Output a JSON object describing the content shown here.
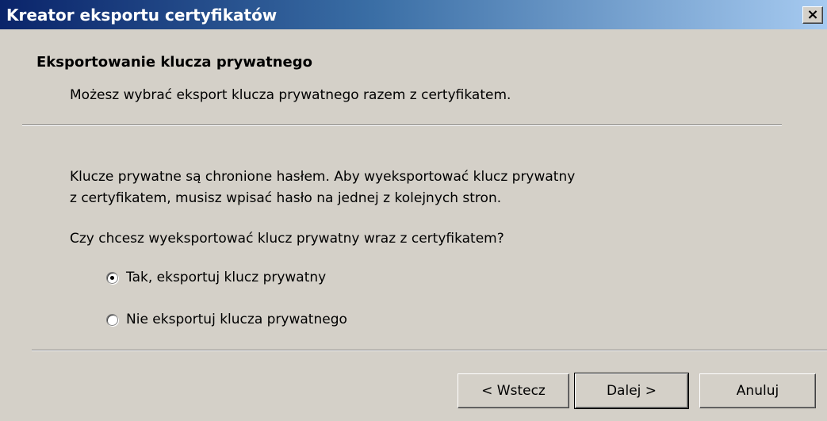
{
  "window": {
    "title": "Kreator eksportu certyfikatów",
    "close_label": "×"
  },
  "header": {
    "title": "Eksportowanie klucza prywatnego",
    "subtitle": "Możesz wybrać eksport klucza prywatnego razem z certyfikatem."
  },
  "body": {
    "info_line1": "Klucze prywatne są chronione hasłem. Aby wyeksportować klucz prywatny",
    "info_line2": "z certyfikatem, musisz wpisać hasło na jednej z kolejnych stron.",
    "question": "Czy chcesz wyeksportować klucz prywatny wraz z certyfikatem?"
  },
  "options": [
    {
      "label": "Tak, eksportuj klucz prywatny",
      "checked": true
    },
    {
      "label": "Nie eksportuj klucza prywatnego",
      "checked": false
    }
  ],
  "buttons": {
    "back": "< Wstecz",
    "next": "Dalej >",
    "cancel": "Anuluj"
  }
}
